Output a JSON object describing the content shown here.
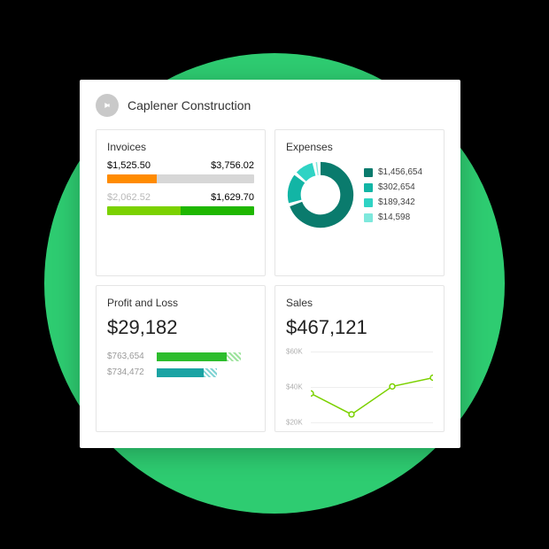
{
  "company": {
    "name": "Caplener Construction"
  },
  "invoices": {
    "title": "Invoices",
    "top_left": "$1,525.50",
    "top_right": "$3,756.02",
    "top_fill_pct": 34,
    "top_fill_color": "#ff8b00",
    "top_track_color": "#d7d7d7",
    "bottom_left": "$2,062.52",
    "bottom_right": "$1,629.70",
    "bottom_left_pct": 50,
    "bottom_color_a": "#7bd100",
    "bottom_color_b": "#1fb700"
  },
  "expenses": {
    "title": "Expenses",
    "items": [
      {
        "label": "$1,456,654",
        "color": "#0a7b6d",
        "value": 1456654
      },
      {
        "label": "$302,654",
        "color": "#12b5a5",
        "value": 302654
      },
      {
        "label": "$189,342",
        "color": "#2fd3c4",
        "value": 189342
      },
      {
        "label": "$14,598",
        "color": "#7ee8dc",
        "value": 14598
      }
    ]
  },
  "profit_loss": {
    "title": "Profit and Loss",
    "total": "$29,182",
    "rows": [
      {
        "label": "$763,654",
        "color": "#2dbd2d",
        "hatch": "#9de39d",
        "solid_pct": 72,
        "hatch_pct": 14
      },
      {
        "label": "$734,472",
        "color": "#1aa3a3",
        "hatch": "#7fd3d3",
        "solid_pct": 48,
        "hatch_pct": 14
      }
    ]
  },
  "sales": {
    "title": "Sales",
    "total": "$467,121",
    "y_ticks": [
      "$60K",
      "$40K",
      "$20K"
    ]
  },
  "chart_data": [
    {
      "type": "bar",
      "title": "Invoices",
      "series": [
        {
          "name": "row1",
          "values": [
            1525.5,
            3756.02
          ],
          "color_left": "#ff8b00"
        },
        {
          "name": "row2",
          "values": [
            2062.52,
            1629.7
          ],
          "color_left": "#7bd100",
          "color_right": "#1fb700"
        }
      ]
    },
    {
      "type": "pie",
      "title": "Expenses",
      "values": [
        1456654,
        302654,
        189342,
        14598
      ],
      "labels": [
        "$1,456,654",
        "$302,654",
        "$189,342",
        "$14,598"
      ],
      "colors": [
        "#0a7b6d",
        "#12b5a5",
        "#2fd3c4",
        "#7ee8dc"
      ]
    },
    {
      "type": "bar",
      "title": "Profit and Loss",
      "categories": [
        "$763,654",
        "$734,472"
      ],
      "values": [
        763654,
        734472
      ],
      "total": 29182
    },
    {
      "type": "line",
      "title": "Sales",
      "ylabel": "",
      "ylim": [
        20000,
        60000
      ],
      "y_ticks": [
        60000,
        40000,
        20000
      ],
      "x": [
        0,
        1,
        2,
        3
      ],
      "values": [
        36000,
        24000,
        40000,
        45000
      ],
      "total": 467121
    }
  ]
}
